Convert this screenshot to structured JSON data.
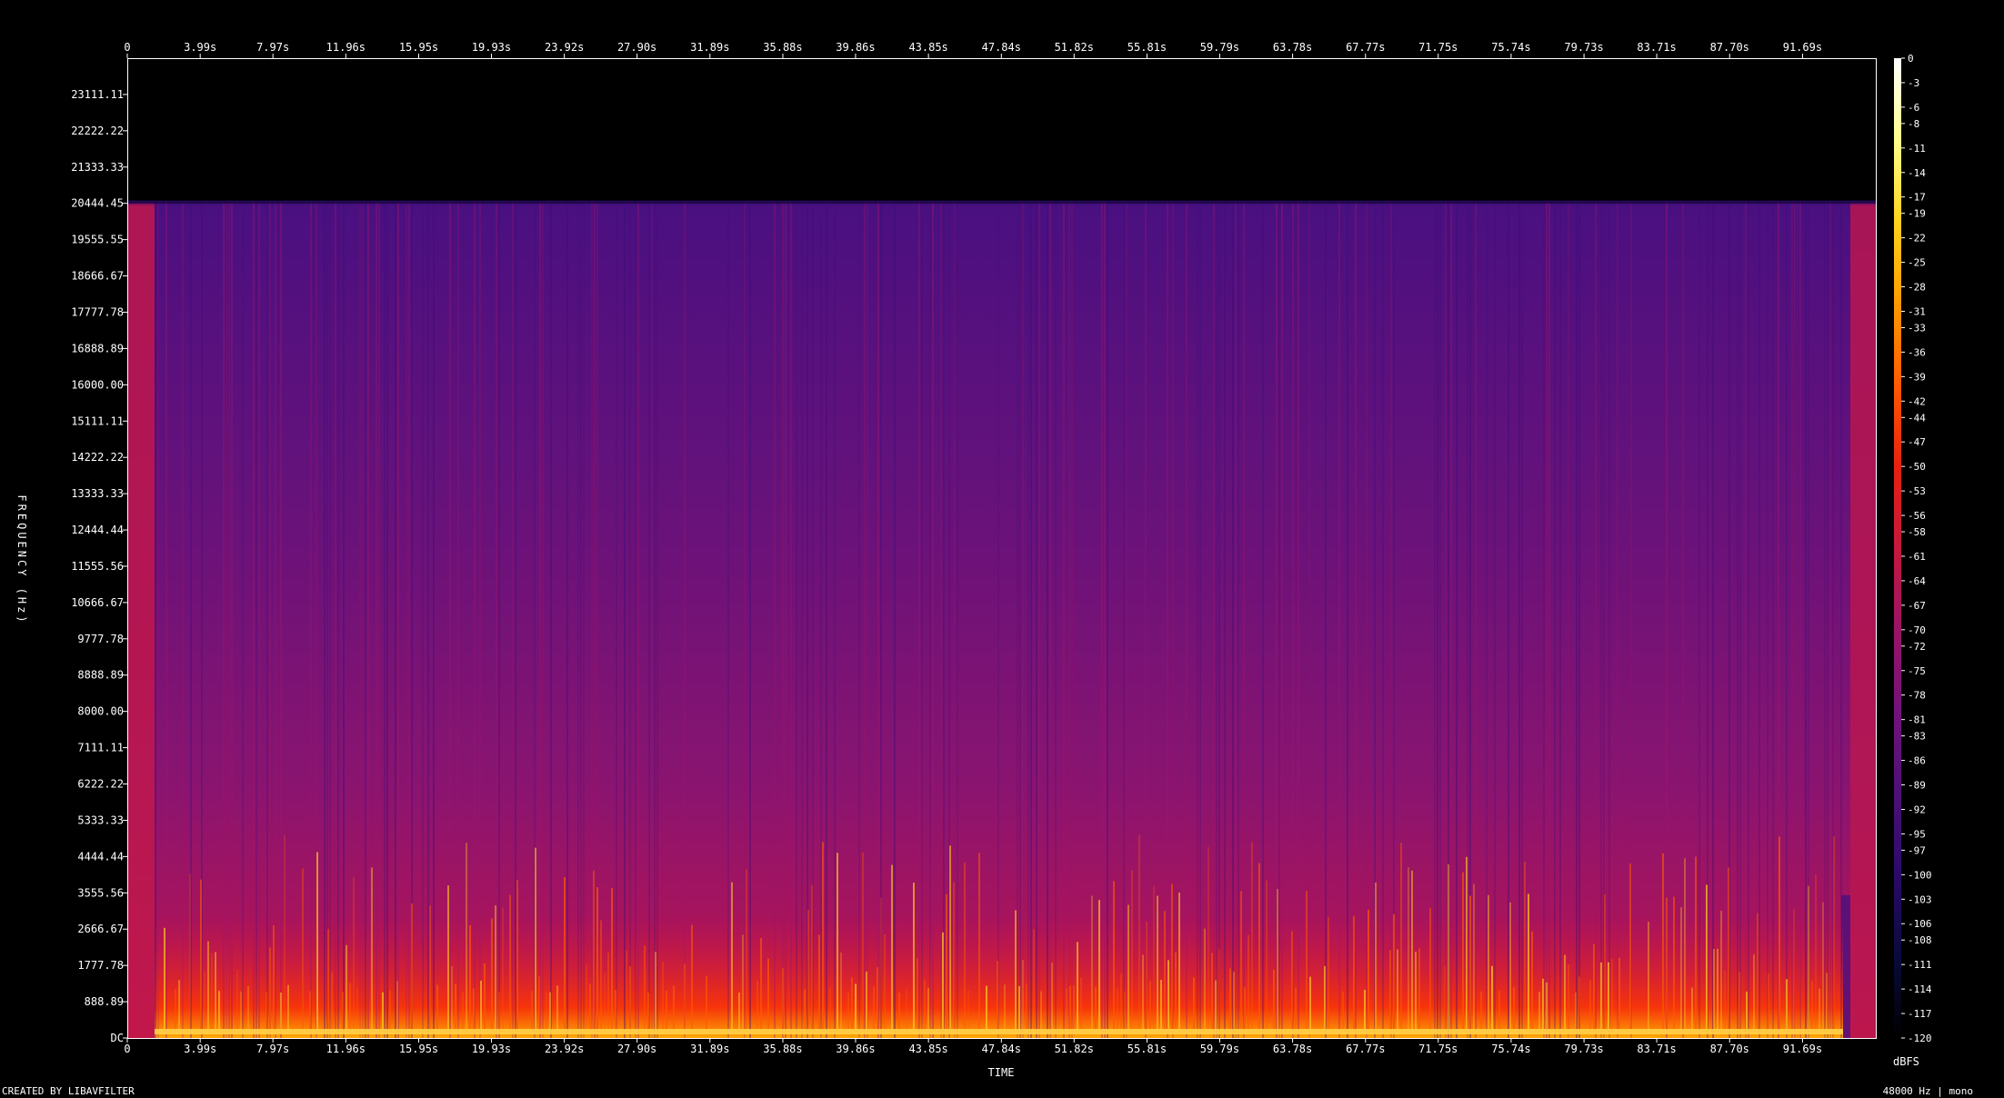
{
  "chart_data": {
    "type": "heatmap",
    "title": "",
    "xlabel": "TIME",
    "ylabel": "FREQUENCY (Hz)",
    "x_ticks": [
      "0",
      "3.99s",
      "7.97s",
      "11.96s",
      "15.95s",
      "19.93s",
      "23.92s",
      "27.90s",
      "31.89s",
      "35.88s",
      "39.86s",
      "43.85s",
      "47.84s",
      "51.82s",
      "55.81s",
      "59.79s",
      "63.78s",
      "67.77s",
      "71.75s",
      "75.74s",
      "79.73s",
      "83.71s",
      "87.70s",
      "91.69s"
    ],
    "x_tick_values": [
      0,
      3.99,
      7.97,
      11.96,
      15.95,
      19.93,
      23.92,
      27.9,
      31.89,
      35.88,
      39.86,
      43.85,
      47.84,
      51.82,
      55.81,
      59.79,
      63.78,
      67.77,
      71.75,
      75.74,
      79.73,
      83.71,
      87.7,
      91.69
    ],
    "xlim": [
      0,
      95.7
    ],
    "y_ticks": [
      "DC",
      "888.89",
      "1777.78",
      "2666.67",
      "3555.56",
      "4444.44",
      "5333.33",
      "6222.22",
      "7111.11",
      "8000.00",
      "8888.89",
      "9777.78",
      "10666.67",
      "11555.56",
      "12444.44",
      "13333.33",
      "14222.22",
      "15111.11",
      "16000.00",
      "16888.89",
      "17777.78",
      "18666.67",
      "19555.55",
      "20444.45",
      "21333.33",
      "22222.22",
      "23111.11"
    ],
    "y_tick_values": [
      0,
      888.89,
      1777.78,
      2666.67,
      3555.56,
      4444.44,
      5333.33,
      6222.22,
      7111.11,
      8000.0,
      8888.89,
      9777.78,
      10666.67,
      11555.56,
      12444.44,
      13333.33,
      14222.22,
      15111.11,
      16000.0,
      16888.89,
      17777.78,
      18666.67,
      19555.55,
      20444.45,
      21333.33,
      22222.22,
      23111.11
    ],
    "ylim": [
      0,
      24000
    ],
    "content_cutoff_hz": 20444.45,
    "colorbar": {
      "label": "dBFS",
      "ticks": [
        "0",
        "-3",
        "-6",
        "-8",
        "-11",
        "-14",
        "-17",
        "-19",
        "-22",
        "-25",
        "-28",
        "-31",
        "-33",
        "-36",
        "-39",
        "-42",
        "-44",
        "-47",
        "-50",
        "-53",
        "-56",
        "-58",
        "-61",
        "-64",
        "-67",
        "-70",
        "-72",
        "-75",
        "-78",
        "-81",
        "-83",
        "-86",
        "-89",
        "-92",
        "-95",
        "-97",
        "-100",
        "-103",
        "-106",
        "-108",
        "-111",
        "-114",
        "-117",
        "-120"
      ],
      "range": [
        -120,
        0
      ],
      "colors": [
        "#000000",
        "#0a0a3c",
        "#2a0a6a",
        "#4e1078",
        "#72127a",
        "#9a1466",
        "#c4183e",
        "#e8200e",
        "#ff5a00",
        "#ff9a00",
        "#ffd21e",
        "#ffff8c",
        "#ffffff"
      ]
    },
    "footer_left": "CREATED BY LIBAVFILTER",
    "footer_right": "48000 Hz | mono"
  }
}
